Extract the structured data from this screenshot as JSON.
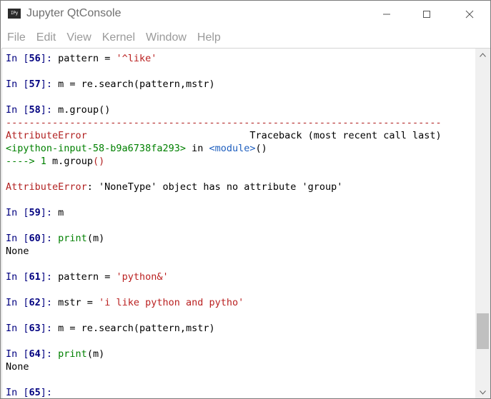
{
  "window": {
    "title": "Jupyter QtConsole",
    "icon_label": "IPy"
  },
  "menu": [
    "File",
    "Edit",
    "View",
    "Kernel",
    "Window",
    "Help"
  ],
  "console": {
    "lines": [
      {
        "type": "in",
        "num": "56",
        "code": [
          {
            "t": "pattern = ",
            "c": ""
          },
          {
            "t": "'^like'",
            "c": "str"
          }
        ]
      },
      {
        "type": "blank"
      },
      {
        "type": "in",
        "num": "57",
        "code": [
          {
            "t": "m = re.search(pattern,mstr)",
            "c": ""
          }
        ]
      },
      {
        "type": "blank"
      },
      {
        "type": "in",
        "num": "58",
        "code": [
          {
            "t": "m.group()",
            "c": ""
          }
        ]
      },
      {
        "type": "raw",
        "segs": [
          {
            "t": "---------------------------------------------------------------------------",
            "c": "err-sep"
          }
        ]
      },
      {
        "type": "raw",
        "segs": [
          {
            "t": "AttributeError",
            "c": "err"
          },
          {
            "t": "                            Traceback (most recent call last)",
            "c": ""
          }
        ]
      },
      {
        "type": "raw",
        "segs": [
          {
            "t": "<ipython-input-58-b9a6738fa293>",
            "c": "fname"
          },
          {
            "t": " in ",
            "c": ""
          },
          {
            "t": "<module>",
            "c": "modname"
          },
          {
            "t": "()",
            "c": ""
          }
        ]
      },
      {
        "type": "raw",
        "segs": [
          {
            "t": "----> 1 ",
            "c": "arrow"
          },
          {
            "t": "m",
            "c": ""
          },
          {
            "t": ".",
            "c": ""
          },
          {
            "t": "group",
            "c": ""
          },
          {
            "t": "()",
            "c": "call"
          }
        ]
      },
      {
        "type": "blank"
      },
      {
        "type": "raw",
        "segs": [
          {
            "t": "AttributeError",
            "c": "err"
          },
          {
            "t": ": 'NoneType' object has no attribute 'group'",
            "c": ""
          }
        ]
      },
      {
        "type": "blank"
      },
      {
        "type": "in",
        "num": "59",
        "code": [
          {
            "t": "m",
            "c": ""
          }
        ]
      },
      {
        "type": "blank"
      },
      {
        "type": "in",
        "num": "60",
        "code": [
          {
            "t": "print",
            "c": "builtin"
          },
          {
            "t": "(m)",
            "c": ""
          }
        ]
      },
      {
        "type": "raw",
        "segs": [
          {
            "t": "None",
            "c": ""
          }
        ]
      },
      {
        "type": "blank"
      },
      {
        "type": "in",
        "num": "61",
        "code": [
          {
            "t": "pattern = ",
            "c": ""
          },
          {
            "t": "'python&'",
            "c": "str"
          }
        ]
      },
      {
        "type": "blank"
      },
      {
        "type": "in",
        "num": "62",
        "code": [
          {
            "t": "mstr = ",
            "c": ""
          },
          {
            "t": "'i like python and pytho'",
            "c": "str"
          }
        ]
      },
      {
        "type": "blank"
      },
      {
        "type": "in",
        "num": "63",
        "code": [
          {
            "t": "m = re.search(pattern,mstr)",
            "c": ""
          }
        ]
      },
      {
        "type": "blank"
      },
      {
        "type": "in",
        "num": "64",
        "code": [
          {
            "t": "print",
            "c": "builtin"
          },
          {
            "t": "(m)",
            "c": ""
          }
        ]
      },
      {
        "type": "raw",
        "segs": [
          {
            "t": "None",
            "c": ""
          }
        ]
      },
      {
        "type": "blank"
      },
      {
        "type": "in",
        "num": "65",
        "code": []
      }
    ]
  },
  "scrollbar": {
    "position_fraction": 0.92
  },
  "icons": {
    "minimize": "minimize-icon",
    "maximize": "maximize-icon",
    "close": "close-icon",
    "scroll_up": "chevron-up-icon",
    "scroll_down": "chevron-down-icon"
  }
}
